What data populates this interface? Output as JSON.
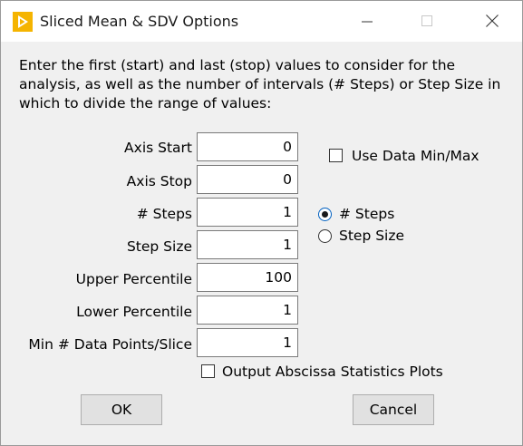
{
  "window": {
    "title": "Sliced Mean & SDV Options"
  },
  "instructions": "Enter the first (start) and last (stop) values to consider for the analysis, as well as the number of intervals (# Steps) or Step Size in which to divide the range of values:",
  "fields": [
    {
      "label": "Axis Start",
      "value": "0"
    },
    {
      "label": "Axis Stop",
      "value": "0"
    },
    {
      "label": "# Steps",
      "value": "1"
    },
    {
      "label": "Step Size",
      "value": "1"
    },
    {
      "label": "Upper Percentile",
      "value": "100"
    },
    {
      "label": "Lower Percentile",
      "value": "1"
    },
    {
      "label": "Min # Data Points/Slice",
      "value": "1"
    }
  ],
  "use_data_minmax": {
    "label": "Use Data Min/Max",
    "checked": false
  },
  "step_mode": {
    "options": [
      {
        "label": "# Steps",
        "checked": true
      },
      {
        "label": "Step Size",
        "checked": false
      }
    ]
  },
  "output_abscissa": {
    "label": "Output Abscissa Statistics Plots",
    "checked": false
  },
  "buttons": {
    "ok": "OK",
    "cancel": "Cancel"
  },
  "icons": {
    "app": "play-triangle-icon",
    "minimize": "minimize-icon",
    "maximize": "maximize-icon",
    "close": "close-icon"
  },
  "colors": {
    "app_icon": "#f5b400",
    "dialog_bg": "#f0f0f0",
    "radio_accent": "#0060c0"
  }
}
